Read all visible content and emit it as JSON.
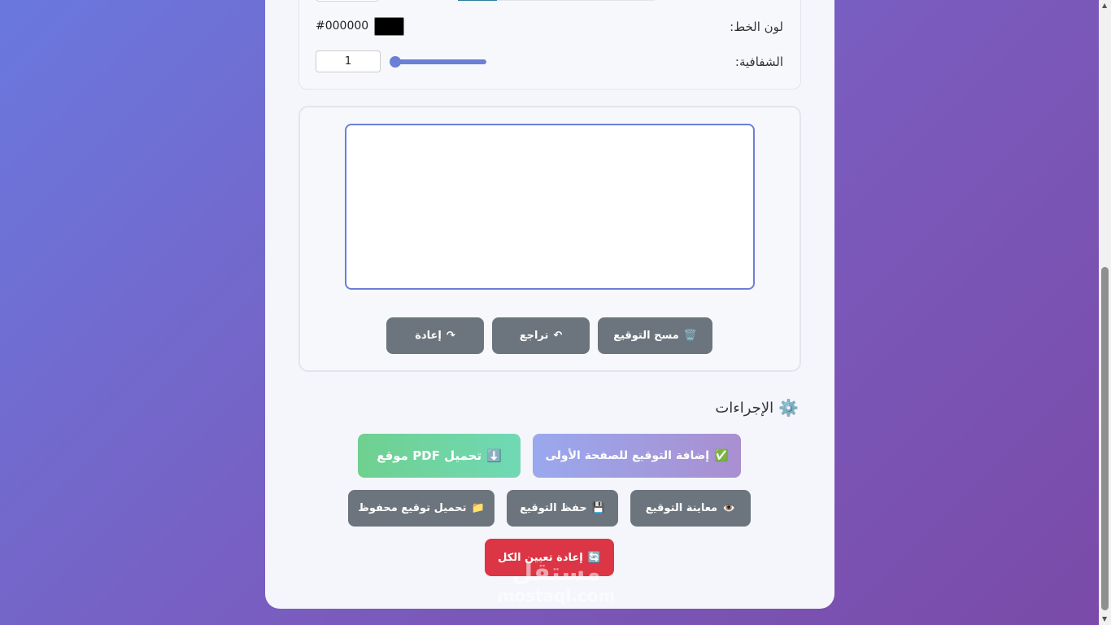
{
  "settings": {
    "line_color_label": "لون الخط:",
    "line_color_value": "#000000",
    "line_color_swatch": "#000000",
    "opacity_label": "الشفافية:",
    "opacity_value": "1"
  },
  "pad": {
    "buttons": {
      "clear": {
        "icon": "🗑️",
        "label": "مسح التوقيع"
      },
      "undo": {
        "icon": "↶",
        "label": "تراجع"
      },
      "redo": {
        "icon": "↷",
        "label": "إعادة"
      }
    }
  },
  "actions": {
    "title": "الإجراءات",
    "title_icon": "⚙️",
    "add_first_page": {
      "icon": "✅",
      "label": "إضافة التوقيع للصفحة الأولى"
    },
    "download_pdf": {
      "icon": "⬇️",
      "label": "تحميل PDF موقع"
    },
    "preview": {
      "icon": "👁️",
      "label": "معاينة التوقيع"
    },
    "save": {
      "icon": "💾",
      "label": "حفظ التوقيع"
    },
    "load_saved": {
      "icon": "📁",
      "label": "تحميل توقيع محفوظ"
    },
    "reset_all": {
      "icon": "🔄",
      "label": "إعادة تعيين الكل"
    }
  },
  "watermark": {
    "arabic": "مستقل",
    "latin": "mostaql.com"
  },
  "colors": {
    "accent": "#6b7fd7",
    "gray_button": "#6c757d",
    "danger": "#dc3545",
    "success_gradient_start": "#6fd08f",
    "success_gradient_end": "#70d9b5",
    "primary_gradient_start": "#9aa8ee",
    "primary_gradient_end": "#a98fd0"
  }
}
